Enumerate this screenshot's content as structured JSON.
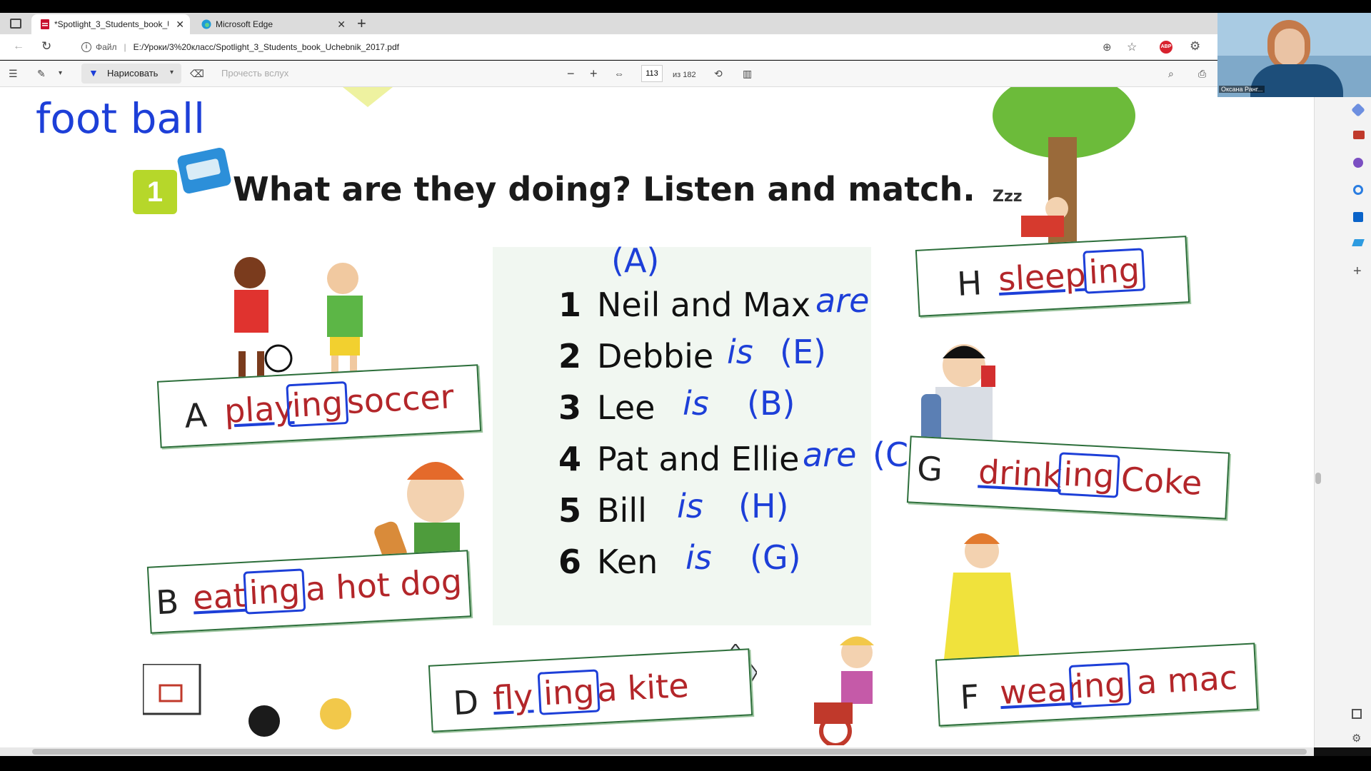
{
  "tabs": [
    {
      "title": "*Spotlight_3_Students_book_Uc",
      "icon": "pdf-icon"
    },
    {
      "title": "Microsoft Edge",
      "icon": "edge-icon"
    }
  ],
  "address": {
    "scheme_label": "Файл",
    "url": "E:/Уроки/3%20класс/Spotlight_3_Students_book_Uchebnik_2017.pdf"
  },
  "pdf_toolbar": {
    "draw_label": "Нарисовать",
    "read_aloud_label": "Прочесть вслух",
    "page_current": "113",
    "page_total": "из 182"
  },
  "camera": {
    "name_label": "Оксана Ранг..."
  },
  "page": {
    "handwritten_title": "foot ball",
    "exercise_number": "1",
    "heading": "What are they doing? Listen and match.",
    "sentences": [
      {
        "num": "1",
        "text": "Neil and Max",
        "answer": "are",
        "choice": "(A)"
      },
      {
        "num": "2",
        "text": "Debbie",
        "answer": "is",
        "choice": "(E)"
      },
      {
        "num": "3",
        "text": "Lee",
        "answer": "is",
        "choice": "(B)"
      },
      {
        "num": "4",
        "text": "Pat and Ellie",
        "answer": "are",
        "choice": "(C)"
      },
      {
        "num": "5",
        "text": "Bill",
        "answer": "is",
        "choice": "(H)"
      },
      {
        "num": "6",
        "text": "Ken",
        "answer": "is",
        "choice": "(G)"
      }
    ],
    "labels": [
      {
        "letter": "A",
        "stem": "play",
        "suffix": "ing",
        "rest": "soccer"
      },
      {
        "letter": "B",
        "stem": "eat",
        "suffix": "ing",
        "rest": "a hot dog"
      },
      {
        "letter": "D",
        "stem": "fly",
        "suffix": "ing",
        "rest": "a kite"
      },
      {
        "letter": "H",
        "stem": "sleep",
        "suffix": "ing",
        "rest": ""
      },
      {
        "letter": "G",
        "stem": "drink",
        "suffix": "ing",
        "rest": "Coke"
      },
      {
        "letter": "F",
        "stem": "wear",
        "suffix": "ing",
        "rest": "a mac"
      }
    ]
  },
  "colors": {
    "ink": "#1d3fd8",
    "label_red": "#b3262a",
    "frame_green": "#2c6e3a",
    "badge_green": "#b6d72a"
  }
}
